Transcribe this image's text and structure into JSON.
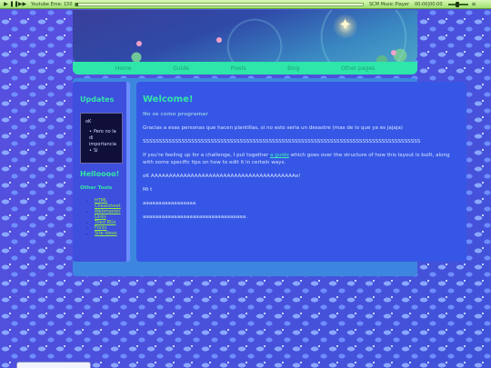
{
  "player": {
    "title": "Youtube Eme: 150",
    "music_label": "SCM Music Player",
    "time": "00:00|00:00",
    "icons": [
      "play-icon",
      "pause-icon",
      "next-icon"
    ],
    "progress": 0,
    "volume": 0.45,
    "colors": {
      "bar": "#9ee06e",
      "text": "#2b4a18"
    }
  },
  "nav": {
    "items": [
      "Home",
      "Guide",
      "Pixels",
      "Blog",
      "Other pages"
    ]
  },
  "sidebar": {
    "updates_heading": "Updates",
    "updates_box": {
      "line": "oK",
      "items": [
        "Pero no la di importancia",
        "Sí"
      ]
    },
    "hello_heading": "Helloooo!",
    "tools_heading": "Other Tools",
    "tools": [
      "HTML Cheatsheet",
      "Webmaster Links",
      "Tiled BGs",
      "Fonts",
      "Site Ideas"
    ]
  },
  "main": {
    "title": "Welcome!",
    "subtitle": "No se como programar",
    "para1": "Gracias a esas personas que hacen plantillas, si no esto seria un desastre (mas de lo que ya es jajaja)",
    "para2": "SSSSSSSSSSSSSSSSSSSSSSSSSSSSSSSSSSSSSSSSSSSSSSSSSSSSSSSSSSSSSSSSSSSSSSSSSSSSSSSSSSSSSS",
    "para3_before": "If you're feeling up for a challenge, I put together ",
    "para3_link": "a guide",
    "para3_after": " which goes over the structure of how this layout is built, along with some specific tips on how to edit it in certain ways.",
    "para4": "oK AAAAAAAAAAAAAAAAAAAAAAAAAAAAAAAAAAAAAAAAe!",
    "para5": "Mi t",
    "para6": "aaaaaaaaaaaaaaaaa",
    "para7": "aaaaaaaaaaaaaaaaaaaaaaaaaaaaaaaaa."
  },
  "colors": {
    "accent": "#34e6a6",
    "nav_bg": "#2ee6a9",
    "content_bg": "#3657e6",
    "link": "#8ef03c"
  }
}
